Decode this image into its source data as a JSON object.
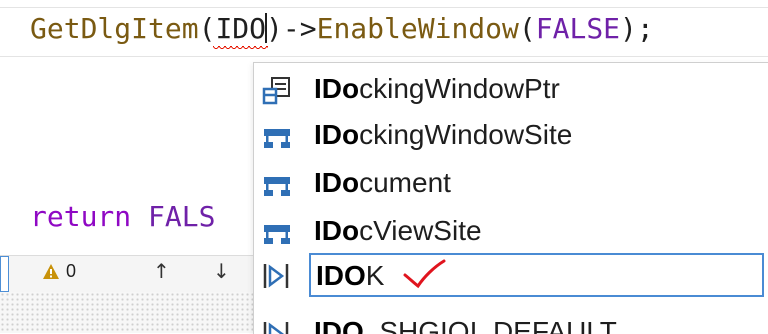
{
  "editor": {
    "line1": {
      "func": "GetDlgItem",
      "open_paren": "(",
      "typed_before_caret": "IDO",
      "after_caret": ")->",
      "method": "EnableWindow",
      "paren2": "(",
      "macro": "FALSE",
      "end": ");"
    },
    "line2": {
      "keyword": "return",
      "value_partial": "FALS"
    }
  },
  "status_bar": {
    "warning_count": "0",
    "up_arrow": "↑",
    "down_arrow": "↓"
  },
  "autocomplete": {
    "items": [
      {
        "bold": "IDo",
        "rest": "ckingWindowPtr",
        "icon": "typedef-icon"
      },
      {
        "bold": "IDo",
        "rest": "ckingWindowSite",
        "icon": "struct-icon"
      },
      {
        "bold": "IDo",
        "rest": "cument",
        "icon": "struct-icon"
      },
      {
        "bold": "IDo",
        "rest": "cViewSite",
        "icon": "struct-icon"
      },
      {
        "bold": "IDO",
        "rest": "K",
        "icon": "macro-icon",
        "selected": true
      },
      {
        "bold": "IDO",
        "rest": "_SHGIOI_DEFAULT",
        "icon": "macro-icon"
      }
    ]
  },
  "colors": {
    "function": "#7a5a12",
    "macro": "#6f21a8",
    "keyword": "#8f08c4",
    "selection_border": "#4a8bd4",
    "check_mark": "#e0141e",
    "icon_blue": "#2f6fb5"
  }
}
